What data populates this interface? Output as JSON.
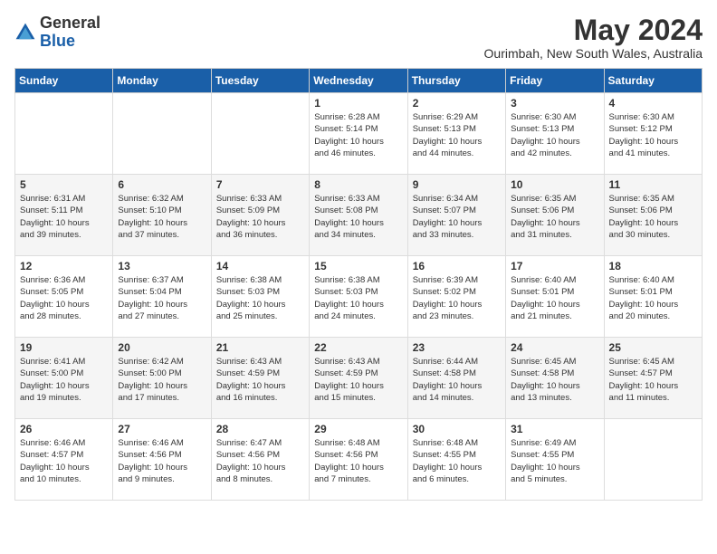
{
  "header": {
    "logo_general": "General",
    "logo_blue": "Blue",
    "title": "May 2024",
    "subtitle": "Ourimbah, New South Wales, Australia"
  },
  "days_of_week": [
    "Sunday",
    "Monday",
    "Tuesday",
    "Wednesday",
    "Thursday",
    "Friday",
    "Saturday"
  ],
  "weeks": [
    [
      {
        "day": "",
        "info": ""
      },
      {
        "day": "",
        "info": ""
      },
      {
        "day": "",
        "info": ""
      },
      {
        "day": "1",
        "info": "Sunrise: 6:28 AM\nSunset: 5:14 PM\nDaylight: 10 hours\nand 46 minutes."
      },
      {
        "day": "2",
        "info": "Sunrise: 6:29 AM\nSunset: 5:13 PM\nDaylight: 10 hours\nand 44 minutes."
      },
      {
        "day": "3",
        "info": "Sunrise: 6:30 AM\nSunset: 5:13 PM\nDaylight: 10 hours\nand 42 minutes."
      },
      {
        "day": "4",
        "info": "Sunrise: 6:30 AM\nSunset: 5:12 PM\nDaylight: 10 hours\nand 41 minutes."
      }
    ],
    [
      {
        "day": "5",
        "info": "Sunrise: 6:31 AM\nSunset: 5:11 PM\nDaylight: 10 hours\nand 39 minutes."
      },
      {
        "day": "6",
        "info": "Sunrise: 6:32 AM\nSunset: 5:10 PM\nDaylight: 10 hours\nand 37 minutes."
      },
      {
        "day": "7",
        "info": "Sunrise: 6:33 AM\nSunset: 5:09 PM\nDaylight: 10 hours\nand 36 minutes."
      },
      {
        "day": "8",
        "info": "Sunrise: 6:33 AM\nSunset: 5:08 PM\nDaylight: 10 hours\nand 34 minutes."
      },
      {
        "day": "9",
        "info": "Sunrise: 6:34 AM\nSunset: 5:07 PM\nDaylight: 10 hours\nand 33 minutes."
      },
      {
        "day": "10",
        "info": "Sunrise: 6:35 AM\nSunset: 5:06 PM\nDaylight: 10 hours\nand 31 minutes."
      },
      {
        "day": "11",
        "info": "Sunrise: 6:35 AM\nSunset: 5:06 PM\nDaylight: 10 hours\nand 30 minutes."
      }
    ],
    [
      {
        "day": "12",
        "info": "Sunrise: 6:36 AM\nSunset: 5:05 PM\nDaylight: 10 hours\nand 28 minutes."
      },
      {
        "day": "13",
        "info": "Sunrise: 6:37 AM\nSunset: 5:04 PM\nDaylight: 10 hours\nand 27 minutes."
      },
      {
        "day": "14",
        "info": "Sunrise: 6:38 AM\nSunset: 5:03 PM\nDaylight: 10 hours\nand 25 minutes."
      },
      {
        "day": "15",
        "info": "Sunrise: 6:38 AM\nSunset: 5:03 PM\nDaylight: 10 hours\nand 24 minutes."
      },
      {
        "day": "16",
        "info": "Sunrise: 6:39 AM\nSunset: 5:02 PM\nDaylight: 10 hours\nand 23 minutes."
      },
      {
        "day": "17",
        "info": "Sunrise: 6:40 AM\nSunset: 5:01 PM\nDaylight: 10 hours\nand 21 minutes."
      },
      {
        "day": "18",
        "info": "Sunrise: 6:40 AM\nSunset: 5:01 PM\nDaylight: 10 hours\nand 20 minutes."
      }
    ],
    [
      {
        "day": "19",
        "info": "Sunrise: 6:41 AM\nSunset: 5:00 PM\nDaylight: 10 hours\nand 19 minutes."
      },
      {
        "day": "20",
        "info": "Sunrise: 6:42 AM\nSunset: 5:00 PM\nDaylight: 10 hours\nand 17 minutes."
      },
      {
        "day": "21",
        "info": "Sunrise: 6:43 AM\nSunset: 4:59 PM\nDaylight: 10 hours\nand 16 minutes."
      },
      {
        "day": "22",
        "info": "Sunrise: 6:43 AM\nSunset: 4:59 PM\nDaylight: 10 hours\nand 15 minutes."
      },
      {
        "day": "23",
        "info": "Sunrise: 6:44 AM\nSunset: 4:58 PM\nDaylight: 10 hours\nand 14 minutes."
      },
      {
        "day": "24",
        "info": "Sunrise: 6:45 AM\nSunset: 4:58 PM\nDaylight: 10 hours\nand 13 minutes."
      },
      {
        "day": "25",
        "info": "Sunrise: 6:45 AM\nSunset: 4:57 PM\nDaylight: 10 hours\nand 11 minutes."
      }
    ],
    [
      {
        "day": "26",
        "info": "Sunrise: 6:46 AM\nSunset: 4:57 PM\nDaylight: 10 hours\nand 10 minutes."
      },
      {
        "day": "27",
        "info": "Sunrise: 6:46 AM\nSunset: 4:56 PM\nDaylight: 10 hours\nand 9 minutes."
      },
      {
        "day": "28",
        "info": "Sunrise: 6:47 AM\nSunset: 4:56 PM\nDaylight: 10 hours\nand 8 minutes."
      },
      {
        "day": "29",
        "info": "Sunrise: 6:48 AM\nSunset: 4:56 PM\nDaylight: 10 hours\nand 7 minutes."
      },
      {
        "day": "30",
        "info": "Sunrise: 6:48 AM\nSunset: 4:55 PM\nDaylight: 10 hours\nand 6 minutes."
      },
      {
        "day": "31",
        "info": "Sunrise: 6:49 AM\nSunset: 4:55 PM\nDaylight: 10 hours\nand 5 minutes."
      },
      {
        "day": "",
        "info": ""
      }
    ]
  ]
}
